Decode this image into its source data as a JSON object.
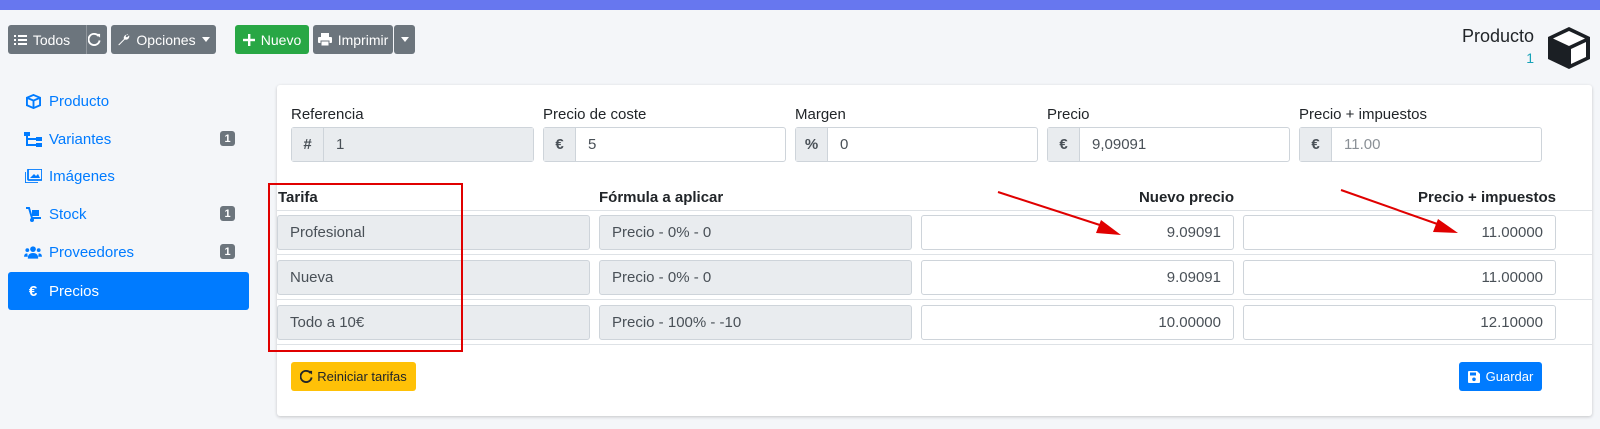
{
  "toolbar": {
    "all_label": "Todos",
    "options_label": "Opciones",
    "new_label": "Nuevo",
    "print_label": "Imprimir"
  },
  "header": {
    "title": "Producto",
    "id": "1"
  },
  "sidebar": {
    "items": [
      {
        "label": "Producto",
        "icon": "cube-icon",
        "badge": ""
      },
      {
        "label": "Variantes",
        "icon": "sitemap-icon",
        "badge": "1"
      },
      {
        "label": "Imágenes",
        "icon": "images-icon",
        "badge": ""
      },
      {
        "label": "Stock",
        "icon": "dolly-icon",
        "badge": "1"
      },
      {
        "label": "Proveedores",
        "icon": "users-icon",
        "badge": "1"
      },
      {
        "label": "Precios",
        "icon": "euro-icon",
        "badge": "",
        "active": true
      }
    ]
  },
  "fields": {
    "reference": {
      "label": "Referencia",
      "prefix": "#",
      "value": "1"
    },
    "cost": {
      "label": "Precio de coste",
      "prefix": "€",
      "value": "5"
    },
    "margin": {
      "label": "Margen",
      "prefix": "%",
      "value": "0"
    },
    "price": {
      "label": "Precio",
      "prefix": "€",
      "value": "9,09091"
    },
    "price_tax": {
      "label": "Precio + impuestos",
      "prefix": "€",
      "placeholder": "11.00"
    }
  },
  "rates_table": {
    "headers": {
      "rate": "Tarifa",
      "formula": "Fórmula a aplicar",
      "new_price": "Nuevo precio",
      "price_tax": "Precio + impuestos"
    },
    "rows": [
      {
        "rate": "Profesional",
        "formula": "Precio - 0% - 0",
        "new_price": "9.09091",
        "price_tax": "11.00000"
      },
      {
        "rate": "Nueva",
        "formula": "Precio - 0% - 0",
        "new_price": "9.09091",
        "price_tax": "11.00000"
      },
      {
        "rate": "Todo a 10€",
        "formula": "Precio - 100% - -10",
        "new_price": "10.00000",
        "price_tax": "12.10000"
      }
    ]
  },
  "actions": {
    "reset_label": "Reiniciar tarifas",
    "save_label": "Guardar"
  },
  "colors": {
    "accent": "#6777ef",
    "primary": "#007bff",
    "success": "#28a745",
    "warning": "#ffc107",
    "secondary": "#6c757d",
    "annotation": "#e00000"
  }
}
